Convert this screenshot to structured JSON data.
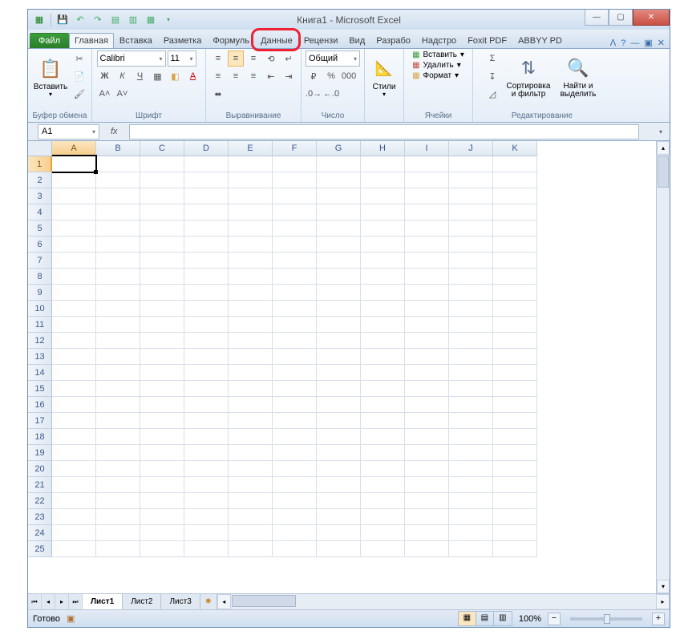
{
  "title": "Книга1  -  Microsoft Excel",
  "tabs": {
    "file": "Файл",
    "list": [
      "Главная",
      "Вставка",
      "Разметка",
      "Формуль",
      "Данные",
      "Рецензи",
      "Вид",
      "Разрабо",
      "Надстро",
      "Foxit PDF",
      "ABBYY PD"
    ],
    "active": "Главная",
    "highlighted": "Данные"
  },
  "ribbon": {
    "clipboard": {
      "paste": "Вставить",
      "label": "Буфер обмена"
    },
    "font": {
      "name": "Calibri",
      "size": "11",
      "label": "Шрифт"
    },
    "alignment": {
      "label": "Выравнивание"
    },
    "number": {
      "format": "Общий",
      "label": "Число"
    },
    "styles": {
      "btn": "Стили"
    },
    "cells": {
      "insert": "Вставить",
      "delete": "Удалить",
      "format": "Формат",
      "label": "Ячейки"
    },
    "editing": {
      "sort": "Сортировка\nи фильтр",
      "sort_l1": "Сортировка",
      "sort_l2": "и фильтр",
      "find": "Найти и\nвыделить",
      "find_l1": "Найти и",
      "find_l2": "выделить",
      "label": "Редактирование"
    }
  },
  "formula_bar": {
    "name_box": "A1",
    "fx_label": "fx"
  },
  "grid": {
    "columns": [
      "A",
      "B",
      "C",
      "D",
      "E",
      "F",
      "G",
      "H",
      "I",
      "J",
      "K"
    ],
    "rows": [
      "1",
      "2",
      "3",
      "4",
      "5",
      "6",
      "7",
      "8",
      "9",
      "10",
      "11",
      "12",
      "13",
      "14",
      "15",
      "16",
      "17",
      "18",
      "19",
      "20",
      "21",
      "22",
      "23",
      "24",
      "25"
    ],
    "selected_cell": "A1"
  },
  "sheet_tabs": {
    "list": [
      "Лист1",
      "Лист2",
      "Лист3"
    ],
    "active": "Лист1"
  },
  "status": {
    "ready": "Готово",
    "zoom": "100%"
  }
}
